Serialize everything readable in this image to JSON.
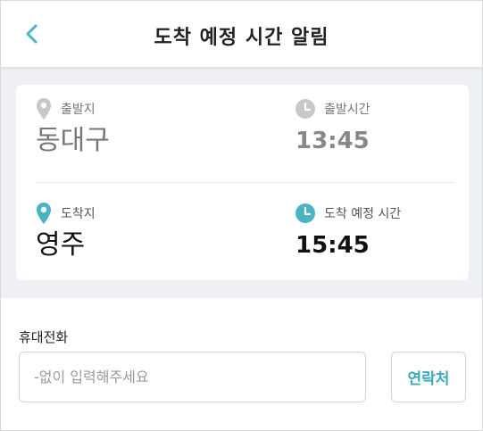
{
  "header": {
    "title": "도착 예정 시간 알림",
    "back_icon": "chevron-left-icon"
  },
  "departure": {
    "place_label": "출발지",
    "place_value": "동대구",
    "time_label": "출발시간",
    "time_value": "13:45",
    "icon_color": "#c8c8c8"
  },
  "arrival": {
    "place_label": "도착지",
    "place_value": "영주",
    "time_label": "도착 예정 시간",
    "time_value": "15:45",
    "icon_color": "#4ab3c4"
  },
  "phone": {
    "label": "휴대전화",
    "placeholder": "-없이 입력해주세요",
    "value": "",
    "contact_button": "연락처"
  },
  "colors": {
    "accent": "#4ab3c4",
    "section_background": "#eef0f4"
  }
}
